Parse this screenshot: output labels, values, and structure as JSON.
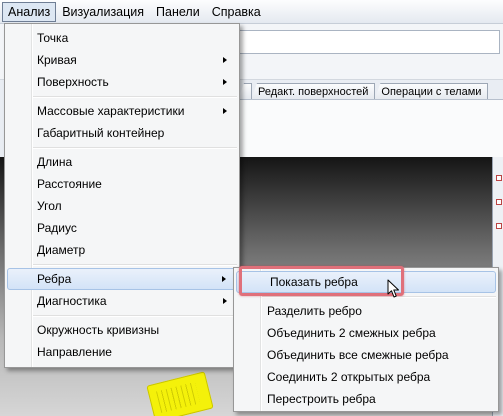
{
  "menubar": {
    "items": [
      "Анализ",
      "Визуализация",
      "Панели",
      "Справка"
    ]
  },
  "tabs": [
    "Редакт. поверхностей",
    "Операции с телами"
  ],
  "analysis_menu": {
    "items": [
      {
        "label": "Точка"
      },
      {
        "label": "Кривая",
        "submenu": true
      },
      {
        "label": "Поверхность",
        "submenu": true
      },
      {
        "label": "Массовые характеристики",
        "submenu": true
      },
      {
        "label": "Габаритный контейнер"
      },
      {
        "label": "Длина"
      },
      {
        "label": "Расстояние"
      },
      {
        "label": "Угол"
      },
      {
        "label": "Радиус"
      },
      {
        "label": "Диаметр"
      },
      {
        "label": "Ребра",
        "submenu": true,
        "highlighted": true
      },
      {
        "label": "Диагностика",
        "submenu": true
      },
      {
        "label": "Окружность кривизны"
      },
      {
        "label": "Направление"
      }
    ]
  },
  "edges_submenu": {
    "items": [
      {
        "label": "Показать ребра",
        "highlighted": true
      },
      {
        "label": "Разделить ребро"
      },
      {
        "label": "Объединить 2 смежных ребра"
      },
      {
        "label": "Объединить все смежные ребра"
      },
      {
        "label": "Соединить 2 открытых ребра"
      },
      {
        "label": "Перестроить ребра"
      }
    ]
  },
  "colors": {
    "highlight_frame": "#e0707a",
    "menu_highlight": "#d3e3f7"
  }
}
